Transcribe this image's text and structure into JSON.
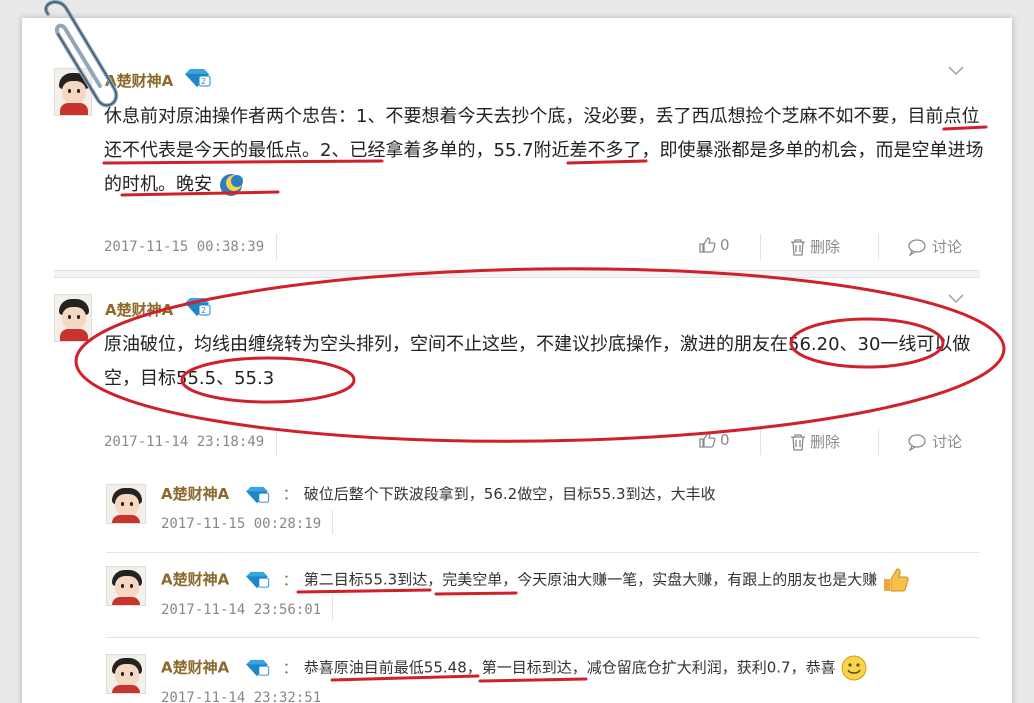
{
  "posts": [
    {
      "author": "A楚财神A",
      "text_parts": [
        "休息前对原油操作者两个忠告：1、不要想着今天去抄个底，没必要，丢了西瓜想捡个芝麻不如不要，",
        "目前点位还不代表是今天的最低点",
        "。2、已经拿着多单的，",
        "55.7附近",
        "差不多了，即使暴涨都是多单的机会，",
        "而是空单进场的时机",
        "。晚安"
      ],
      "timestamp": "2017-11-15 00:38:39",
      "like_count": "0",
      "delete_label": "删除",
      "discuss_label": "讨论"
    },
    {
      "author": "A楚财神A",
      "text": "原油破位，均线由缠绕转为空头排列，空间不止这些，不建议抄底操作，激进的朋友在56.20、30一线可以做空，目标55.5、55.3",
      "timestamp": "2017-11-14 23:18:49",
      "like_count": "0",
      "delete_label": "删除",
      "discuss_label": "讨论",
      "replies": [
        {
          "author": "A楚财神A",
          "text": "破位后整个下跌波段拿到，56.2做空，目标55.3到达，大丰收",
          "timestamp": "2017-11-15 00:28:19"
        },
        {
          "author": "A楚财神A",
          "text": "第二目标55.3到达，完美空单，今天原油大赚一笔，实盘大赚，有跟上的朋友也是大赚",
          "timestamp": "2017-11-14 23:56:01"
        },
        {
          "author": "A楚财神A",
          "text": "恭喜原油目前最低55.48，第一目标到达，减仓留底仓扩大利润，获利0.7，恭喜",
          "timestamp": "2017-11-14 23:32:51"
        }
      ]
    }
  ],
  "reply_colon": "：",
  "icons": {
    "vip": "vip-diamond-icon",
    "like": "thumbs-up-icon",
    "delete": "trash-icon",
    "discuss": "chat-icon",
    "collapse": "chevron-down-icon"
  },
  "colors": {
    "author": "#8b6a2c",
    "annotation": "#d0202a",
    "vip": "#3aa3e0"
  }
}
